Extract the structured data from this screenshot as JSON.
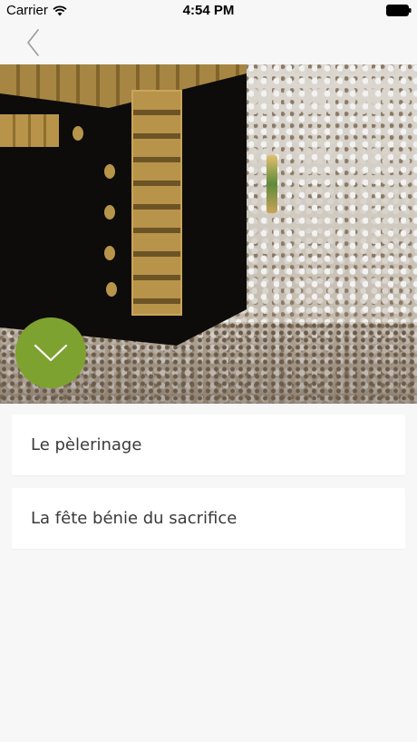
{
  "status_bar": {
    "carrier": "Carrier",
    "time": "4:54 PM",
    "icons": [
      "wifi-icon",
      "battery-icon"
    ]
  },
  "nav": {
    "back_icon": "chevron-left-icon",
    "accent_color": "#7ea22f"
  },
  "hero": {
    "image": "kaaba-crowd-photo",
    "expand_icon": "chevron-down-icon"
  },
  "items": [
    {
      "label": "Le pèlerinage"
    },
    {
      "label": "La fête bénie du sacrifice"
    }
  ],
  "colors": {
    "background": "#f7f7f7",
    "card": "#ffffff",
    "button": "#7ea22f",
    "text": "#3a3a3a"
  }
}
